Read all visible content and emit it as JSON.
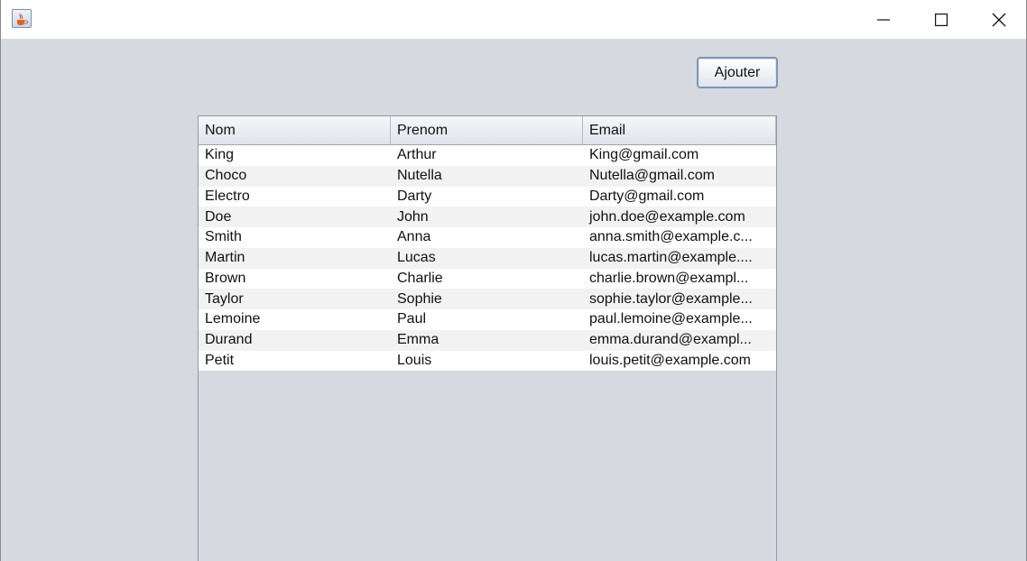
{
  "window": {
    "icon": "java-cup-icon",
    "controls": {
      "minimize": "minimize-icon",
      "maximize": "maximize-icon",
      "close": "close-icon"
    }
  },
  "toolbar": {
    "add_label": "Ajouter"
  },
  "table": {
    "columns": [
      "Nom",
      "Prenom",
      "Email"
    ],
    "rows": [
      [
        "King",
        "Arthur",
        "King@gmail.com"
      ],
      [
        "Choco",
        "Nutella",
        "Nutella@gmail.com"
      ],
      [
        "Electro",
        "Darty",
        "Darty@gmail.com"
      ],
      [
        "Doe",
        "John",
        "john.doe@example.com"
      ],
      [
        "Smith",
        "Anna",
        "anna.smith@example.c..."
      ],
      [
        "Martin",
        "Lucas",
        "lucas.martin@example...."
      ],
      [
        "Brown",
        "Charlie",
        "charlie.brown@exampl..."
      ],
      [
        "Taylor",
        "Sophie",
        "sophie.taylor@example..."
      ],
      [
        "Lemoine",
        "Paul",
        "paul.lemoine@example..."
      ],
      [
        "Durand",
        "Emma",
        "emma.durand@exampl..."
      ],
      [
        "Petit",
        "Louis",
        "louis.petit@example.com"
      ]
    ]
  }
}
